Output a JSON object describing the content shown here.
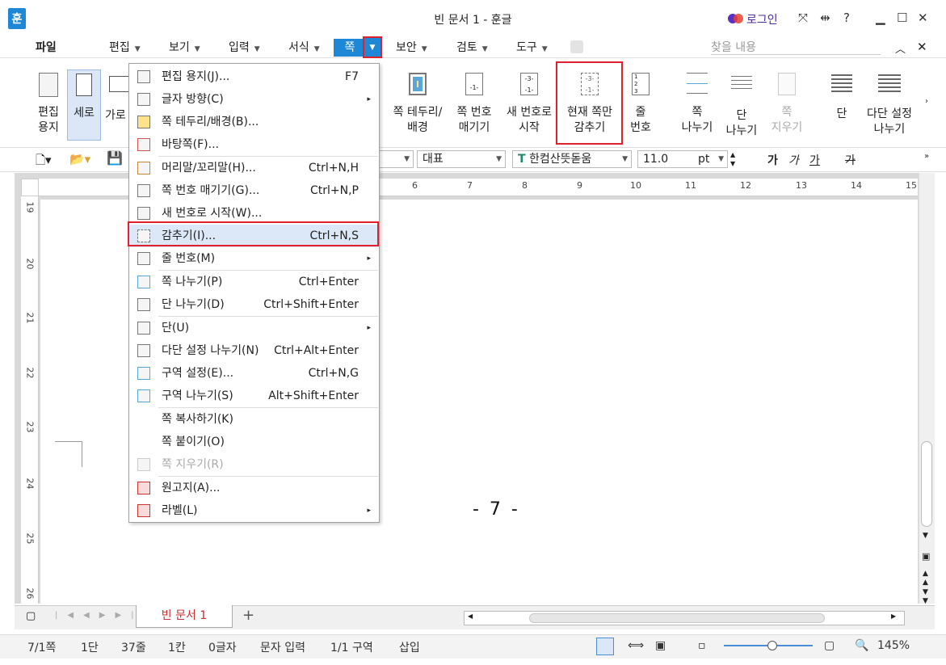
{
  "window": {
    "app_icon": "훈",
    "title": "빈 문서 1 - 훈글",
    "login": "로그인",
    "help": "?",
    "accent": "#1e88d6"
  },
  "menubar": {
    "items": [
      "파일",
      "편집",
      "보기",
      "입력",
      "서식",
      "쪽",
      "보안",
      "검토",
      "도구"
    ],
    "search_placeholder": "찾을 내용"
  },
  "ribbon": {
    "items": [
      {
        "label1": "편집",
        "label2": "용지"
      },
      {
        "label1": "세로",
        "label2": ""
      },
      {
        "label1": "가로",
        "label2": ""
      },
      {
        "label1": "쪽 테두리/",
        "label2": "배경"
      },
      {
        "label1": "쪽 번호",
        "label2": "매기기"
      },
      {
        "label1": "새 번호로",
        "label2": "시작"
      },
      {
        "label1": "현재 쪽만",
        "label2": "감추기"
      },
      {
        "label1": "줄",
        "label2": "번호"
      },
      {
        "label1": "쪽",
        "label2": "나누기"
      },
      {
        "label1": "단",
        "label2": "나누기"
      },
      {
        "label1": "쪽",
        "label2": "지우기"
      },
      {
        "label1": "단",
        "label2": ""
      },
      {
        "label1": "다단 설정",
        "label2": "나누기"
      }
    ]
  },
  "toolbar2": {
    "style": "대표",
    "font": "한컴산뜻돋움",
    "size": "11.0",
    "unit": "pt",
    "fmt": [
      "가",
      "가",
      "가",
      "가"
    ]
  },
  "ruler": {
    "h_ticks": [
      "6",
      "7",
      "8",
      "9",
      "10",
      "11",
      "12",
      "13",
      "14",
      "15"
    ],
    "v_ticks": [
      "19",
      "20",
      "21",
      "22",
      "23",
      "24",
      "25",
      "26"
    ]
  },
  "document": {
    "page_number": "- 7 -",
    "tab_name": "빈 문서 1",
    "add_tab": "+"
  },
  "status": {
    "items": [
      "7/1쪽",
      "1단",
      "37줄",
      "1칸",
      "0글자",
      "문자 입력",
      "1/1 구역",
      "삽입"
    ],
    "zoom": "145%"
  },
  "dropdown": {
    "items": [
      {
        "label": "편집 용지(J)...",
        "shortcut": "F7",
        "sub": ""
      },
      {
        "label": "글자 방향(C)",
        "shortcut": "",
        "sub": "▸"
      },
      {
        "label": "쪽 테두리/배경(B)...",
        "shortcut": "",
        "sub": ""
      },
      {
        "label": "바탕쪽(F)...",
        "shortcut": "",
        "sub": ""
      },
      {
        "label": "머리말/꼬리말(H)...",
        "shortcut": "Ctrl+N,H",
        "sub": ""
      },
      {
        "label": "쪽 번호 매기기(G)...",
        "shortcut": "Ctrl+N,P",
        "sub": ""
      },
      {
        "label": "새 번호로 시작(W)...",
        "shortcut": "",
        "sub": ""
      },
      {
        "label": "감추기(I)...",
        "shortcut": "Ctrl+N,S",
        "sub": ""
      },
      {
        "label": "줄 번호(M)",
        "shortcut": "",
        "sub": "▸"
      },
      {
        "label": "쪽 나누기(P)",
        "shortcut": "Ctrl+Enter",
        "sub": ""
      },
      {
        "label": "단 나누기(D)",
        "shortcut": "Ctrl+Shift+Enter",
        "sub": ""
      },
      {
        "label": "단(U)",
        "shortcut": "",
        "sub": "▸"
      },
      {
        "label": "다단 설정 나누기(N)",
        "shortcut": "Ctrl+Alt+Enter",
        "sub": ""
      },
      {
        "label": "구역 설정(E)...",
        "shortcut": "Ctrl+N,G",
        "sub": ""
      },
      {
        "label": "구역 나누기(S)",
        "shortcut": "Alt+Shift+Enter",
        "sub": ""
      },
      {
        "label": "쪽 복사하기(K)",
        "shortcut": "",
        "sub": ""
      },
      {
        "label": "쪽 붙이기(O)",
        "shortcut": "",
        "sub": ""
      },
      {
        "label": "쪽 지우기(R)",
        "shortcut": "",
        "sub": ""
      },
      {
        "label": "원고지(A)...",
        "shortcut": "",
        "sub": ""
      },
      {
        "label": "라벨(L)",
        "shortcut": "",
        "sub": "▸"
      }
    ]
  }
}
